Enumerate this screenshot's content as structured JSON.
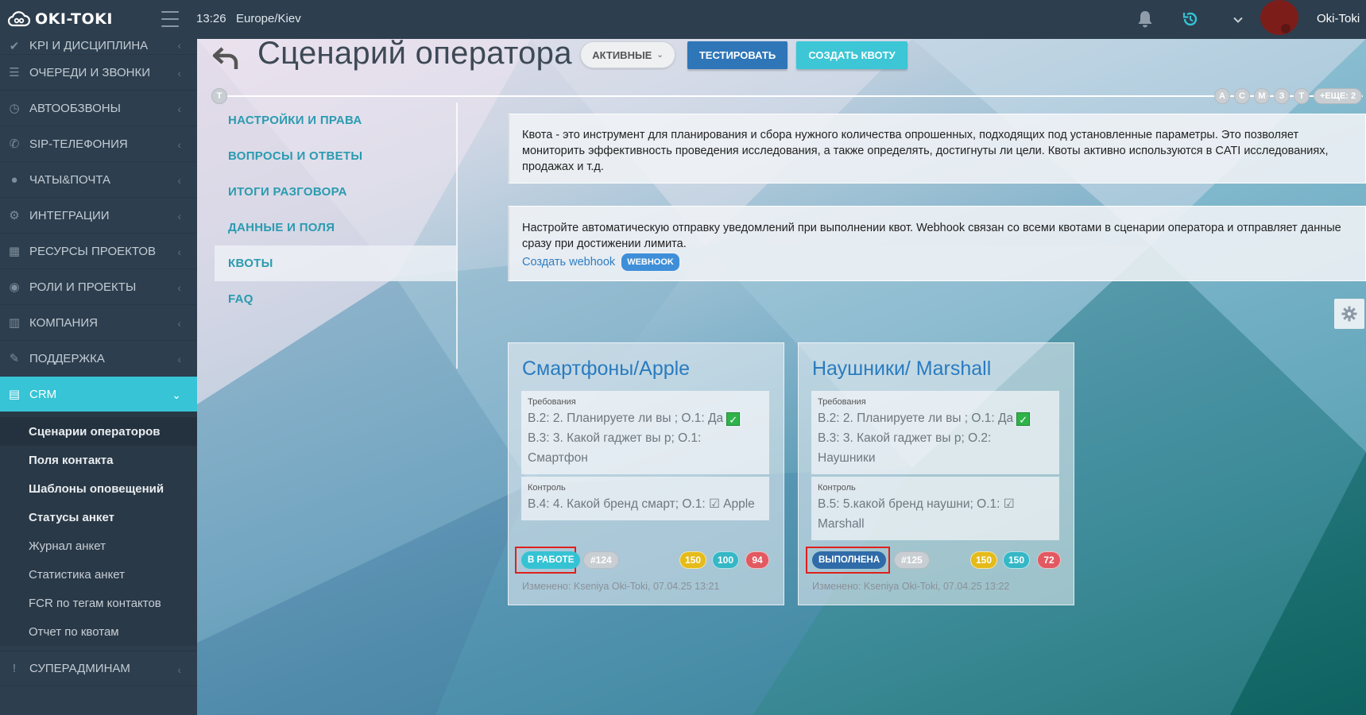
{
  "header": {
    "logo_text": "OKI-TOKI",
    "time": "13:26",
    "timezone": "Europe/Kiev",
    "username": "Oki-Toki",
    "icons": [
      "menu-icon",
      "bell-icon",
      "history-icon",
      "chevron-down-icon",
      "avatar"
    ]
  },
  "sidebar": {
    "items": [
      {
        "label": "KPI И ДИСЦИПЛИНА",
        "icon": "check-icon"
      },
      {
        "label": "ОЧЕРЕДИ И ЗВОНКИ",
        "icon": "list-icon"
      },
      {
        "label": "АВТООБЗВОНЫ",
        "icon": "clock-icon"
      },
      {
        "label": "SIP-ТЕЛЕФОНИЯ",
        "icon": "phone-icon"
      },
      {
        "label": "ЧАТЫ&ПОЧТА",
        "icon": "chat-icon"
      },
      {
        "label": "ИНТЕГРАЦИИ",
        "icon": "gears-icon"
      },
      {
        "label": "РЕСУРСЫ ПРОЕКТОВ",
        "icon": "grid-icon"
      },
      {
        "label": "РОЛИ И ПРОЕКТЫ",
        "icon": "toggle-icon"
      },
      {
        "label": "КОМПАНИЯ",
        "icon": "bar-chart-icon"
      },
      {
        "label": "ПОДДЕРЖКА",
        "icon": "wrench-icon"
      }
    ],
    "crm": {
      "label": "CRM",
      "icon": "crm-icon"
    },
    "submenu": [
      {
        "label": "Сценарии операторов",
        "bold": true,
        "current": true
      },
      {
        "label": "Поля контакта",
        "bold": true
      },
      {
        "label": "Шаблоны оповещений",
        "bold": true
      },
      {
        "label": "Статусы анкет",
        "bold": true
      },
      {
        "label": "Журнал анкет",
        "bold": false
      },
      {
        "label": "Статистика анкет",
        "bold": false
      },
      {
        "label": "FCR по тегам контактов",
        "bold": false
      },
      {
        "label": "Отчет по квотам",
        "bold": false
      }
    ],
    "superadmin": {
      "label": "СУПЕРАДМИНАМ",
      "icon": "exclamation-icon"
    }
  },
  "page": {
    "title": "Сценарий оператора",
    "filter_label": "АКТИВНЫЕ",
    "test_button": "ТЕСТИРОВАТЬ",
    "create_quota_button": "СОЗДАТЬ КВОТУ",
    "timeline": {
      "start": "Т",
      "letters": [
        "А",
        "С",
        "М",
        "З",
        "Т"
      ],
      "more": "+ЕЩЕ: 2"
    }
  },
  "tabs": [
    {
      "label": "НАСТРОЙКИ И ПРАВА"
    },
    {
      "label": "ВОПРОСЫ И ОТВЕТЫ"
    },
    {
      "label": "ИТОГИ РАЗГОВОРА"
    },
    {
      "label": "ДАННЫЕ И ПОЛЯ"
    },
    {
      "label": "КВОТЫ",
      "active": true
    },
    {
      "label": "FAQ"
    }
  ],
  "info": {
    "quota_text": "Квота - это инструмент для планирования и сбора нужного количества опрошенных, подходящих под установленные параметры. Это позволяет мониторить эффективность проведения исследования, а также определять, достигнуты ли цели. Квоты активно используются в CATI исследованиях, продажах и т.д.",
    "webhook_text": "Настройте автоматическую отправку уведомлений при выполнении квот. Webhook связан со всеми квотами в сценарии оператора и отправляет данные сразу при достижении лимита.",
    "webhook_link": "Создать webhook",
    "webhook_badge": "WEBHOOK"
  },
  "cards": [
    {
      "title": "Смартфоны/Apple",
      "req_label": "Требования",
      "req_line1": "В.2: 2. Планируете ли вы ; О.1: Да",
      "req_line2": "В.3: 3. Какой гаджет вы р; О.1:",
      "req_line3": "Смартфон",
      "ctl_label": "Контроль",
      "ctl_line1": "В.4: 4. Какой бренд смарт; О.1: ☑ Apple",
      "ctl_line2": "",
      "status": "В РАБОТЕ",
      "id": "#124",
      "n1": "150",
      "n2": "100",
      "n3": "94",
      "changed": "Изменено: Kseniya Oki-Toki, 07.04.25 13:21"
    },
    {
      "title": "Наушники/ Marshall",
      "req_label": "Требования",
      "req_line1": "В.2: 2. Планируете ли вы ; О.1: Да",
      "req_line2": "В.3: 3. Какой гаджет вы р; О.2:",
      "req_line3": "Наушники",
      "ctl_label": "Контроль",
      "ctl_line1": "В.5: 5.какой бренд наушни; О.1: ☑",
      "ctl_line2": "Marshall",
      "status": "ВЫПОЛНЕНА",
      "id": "#125",
      "n1": "150",
      "n2": "150",
      "n3": "72",
      "changed": "Изменено: Kseniya Oki-Toki, 07.04.25 13:22"
    }
  ],
  "colors": {
    "sidebar_bg": "#2d3e4e",
    "accent_cyan": "#36c4d6",
    "button_blue": "#2f76b8",
    "status_work": "#35c3d4",
    "status_done": "#2f6ba8",
    "badge_yellow": "#e5bb1a",
    "badge_teal": "#35b7c6",
    "badge_red": "#e25961",
    "highlight_red": "#e0201c"
  }
}
